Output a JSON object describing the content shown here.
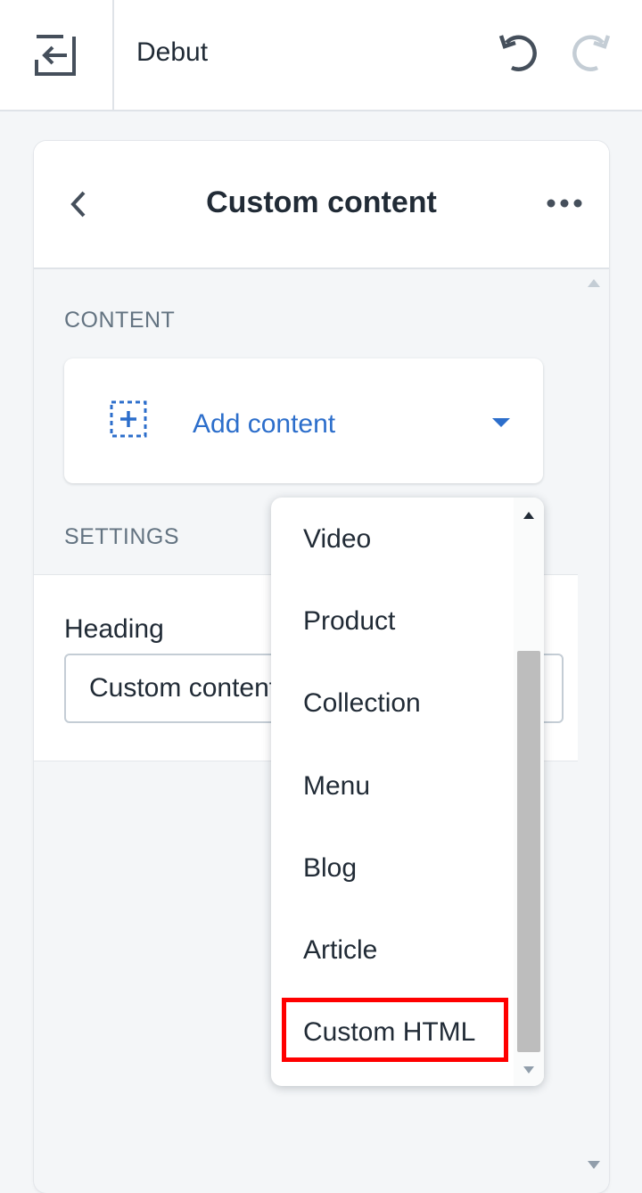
{
  "topbar": {
    "exit_icon": "exit-icon",
    "theme_name": "Debut",
    "undo_icon": "undo-icon",
    "redo_icon": "redo-icon"
  },
  "panel": {
    "title": "Custom content",
    "back_icon": "chevron-left-icon",
    "more_icon": "more-horizontal-icon",
    "content_section": {
      "label": "CONTENT",
      "add_content_label": "Add content",
      "add_icon": "add-block-icon",
      "caret_icon": "caret-down-icon"
    },
    "settings_section": {
      "label": "SETTINGS",
      "heading_label": "Heading",
      "heading_value": "Custom content"
    }
  },
  "dropdown": {
    "items": [
      "Video",
      "Product",
      "Collection",
      "Menu",
      "Blog",
      "Article",
      "Custom HTML"
    ],
    "highlighted": "Custom HTML"
  },
  "colors": {
    "accent": "#2c6ecb",
    "highlight": "#ff0000",
    "background": "#f4f6f8"
  }
}
